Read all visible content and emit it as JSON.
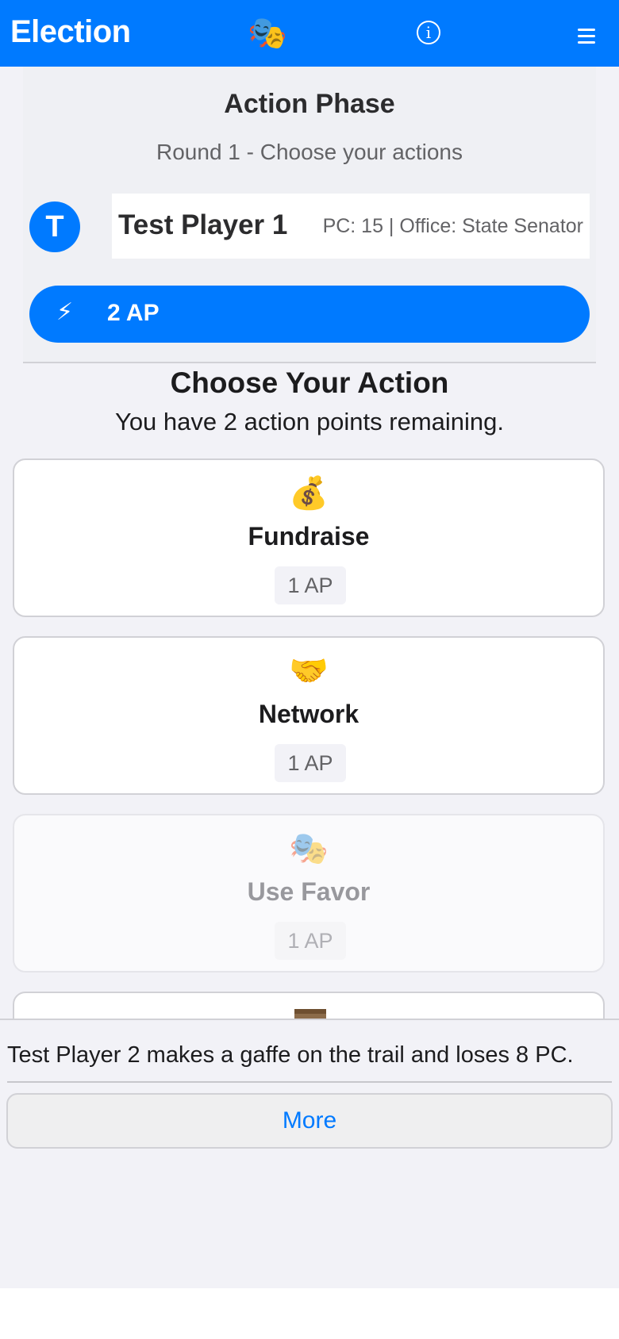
{
  "header": {
    "title": "Election",
    "logo_glyph": "🎭",
    "info_glyph": "i",
    "accent_color": "#007aff"
  },
  "phase": {
    "title": "Action Phase",
    "subtitle": "Round 1 - Choose your actions"
  },
  "player": {
    "avatar_letter": "T",
    "name": "Test Player 1",
    "stats": "PC: 15 | Office: State Senator"
  },
  "ap_bar": {
    "icon": "⚡",
    "label": "2 AP"
  },
  "actions_section": {
    "title": "Choose Your Action",
    "subtitle": "You have 2 action points remaining."
  },
  "actions": [
    {
      "icon": "💰",
      "label": "Fundraise",
      "cost": "1 AP",
      "enabled": true
    },
    {
      "icon": "🤝",
      "label": "Network",
      "cost": "1 AP",
      "enabled": true
    },
    {
      "icon": "🎭",
      "label": "Use Favor",
      "cost": "1 AP",
      "enabled": false
    }
  ],
  "news": {
    "message": "Test Player 2 makes a gaffe on the trail and loses 8 PC.",
    "more_label": "More"
  }
}
